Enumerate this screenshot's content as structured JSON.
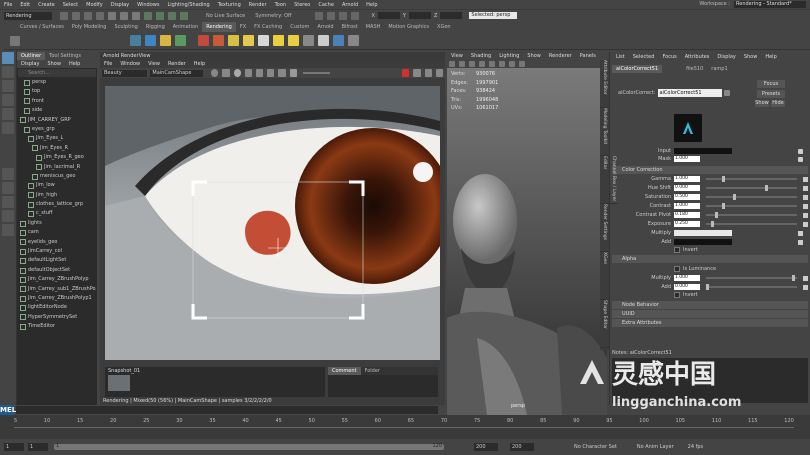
{
  "menubar": {
    "items": [
      "File",
      "Edit",
      "Create",
      "Select",
      "Modify",
      "Display",
      "Windows",
      "Lighting/Shading",
      "Texturing",
      "Render",
      "Toon",
      "Stereo",
      "Cache",
      "Arnold",
      "Help"
    ],
    "workspace_label": "Workspace :",
    "workspace_value": "Rendering - Standard*"
  },
  "statusline": {
    "mode": "Rendering",
    "no_live_surface": "No Live Surface",
    "symmetry": "Symmetry: Off",
    "coord_x": "X",
    "coord_y": "Y",
    "coord_z": "Z",
    "camera_field": "Selected: persp"
  },
  "shelf_tabs": [
    "Curves / Surfaces",
    "Poly Modeling",
    "Sculpting",
    "Rigging",
    "Animation",
    "Rendering",
    "FX",
    "FX Caching",
    "Custom",
    "Arnold",
    "Bifrost",
    "MASH",
    "Motion Graphics",
    "XGen"
  ],
  "outliner": {
    "tabs": [
      "Outliner",
      "Tool Settings"
    ],
    "menu": [
      "Display",
      "Show",
      "Help"
    ],
    "search_placeholder": "Search...",
    "items": [
      "persp",
      "top",
      "front",
      "side",
      "JIM_CARREY_GRP",
      "eyes_grp",
      "Jim_Eyes_L",
      "Jim_Eyes_R",
      "Jim_Eyes_R_geo",
      "Jim_lacrimal_R",
      "meniscus_geo",
      "Jim_low",
      "Jim_high",
      "clothes_lattice_grp",
      "c_stuff",
      "lights",
      "cam",
      "eyelids_geo",
      "JimCarrey_col",
      "defaultLightSet",
      "defaultObjectSet",
      "Jim_Carrey_ZBrushPolyp",
      "Jim_Carrey_sub1_ZBrushPo",
      "Jim_Carrey_ZBrushPolyp1",
      "lightEditorNode",
      "HyperSymmetrySet",
      "TimeEditor"
    ]
  },
  "render_view": {
    "title": "Arnold RenderView",
    "menu": [
      "File",
      "Window",
      "View",
      "Render",
      "Help"
    ],
    "camera": "Beauty",
    "shape": "MainCamShape",
    "snapshot": "Snapshot_01",
    "comment_tab": "Comment",
    "folder_tab": "Folder",
    "status": "Rendering | Mixed(50 (56%) | MainCamShape | samples 3/2/2/2/2/0"
  },
  "viewport": {
    "menu": [
      "View",
      "Shading",
      "Lighting",
      "Show",
      "Renderer",
      "Panels"
    ],
    "hud": [
      {
        "label": "Verts:",
        "value": "930076"
      },
      {
        "label": "Edges:",
        "value": "1997901"
      },
      {
        "label": "Faces:",
        "value": "938424"
      },
      {
        "label": "Tris:",
        "value": "1996048"
      },
      {
        "label": "UVs:",
        "value": "1061017"
      }
    ],
    "camera_label": "persp"
  },
  "attribute_editor": {
    "menu": [
      "List",
      "Selected",
      "Focus",
      "Attributes",
      "Display",
      "Show",
      "Help"
    ],
    "node_tab": "aiColorCorrect51",
    "tab2": "file510",
    "tab3": "ramp1",
    "node_label": "aiColorCorrect:",
    "node_value": "aiColorCorrect51",
    "focus": "Focus",
    "presets": "Presets",
    "show": "Show",
    "hide": "Hide",
    "input_label": "Input",
    "mask_label": "Mask",
    "mask_value": "1.000",
    "section_color_correction": "Color Correction",
    "rows": [
      {
        "label": "Gamma",
        "value": "1.000"
      },
      {
        "label": "Hue Shift",
        "value": "0.000"
      },
      {
        "label": "Saturation",
        "value": "0.500"
      },
      {
        "label": "Contrast",
        "value": "1.000"
      },
      {
        "label": "Contrast Pivot",
        "value": "0.180"
      },
      {
        "label": "Exposure",
        "value": "0.250"
      },
      {
        "label": "Multiply",
        "value": ""
      },
      {
        "label": "Add",
        "value": ""
      }
    ],
    "section_alpha": "Alpha",
    "is_luminance": "Is Luminance",
    "alpha_rows": [
      {
        "label": "Multiply",
        "value": "1.000"
      },
      {
        "label": "Add",
        "value": "0.000"
      }
    ],
    "invert1": "Invert",
    "invert2": "Invert",
    "sections": [
      "Node Behavior",
      "UUID",
      "Extra Attributes"
    ],
    "notes_label": "Notes: aiColorCorrect51",
    "side_tabs": [
      "Attribute Editor",
      "Modeling Toolkit",
      "Channel Box / Layer Editor",
      "Render Settings",
      "XGen",
      "Shape Editor"
    ]
  },
  "timeline": {
    "ticks": [
      "5",
      "10",
      "15",
      "20",
      "25",
      "30",
      "35",
      "40",
      "45",
      "50",
      "55",
      "60",
      "65",
      "70",
      "75",
      "80",
      "85",
      "90",
      "95",
      "100",
      "105",
      "110",
      "115",
      "120"
    ],
    "start": "1",
    "end": "120",
    "range_start": "1",
    "range_end": "120",
    "end2": "200",
    "end3": "200",
    "char_set": "No Character Set",
    "anim_layer": "No Anim Layer",
    "fps": "24 fps"
  },
  "watermark": {
    "brand": "灵感中国",
    "url": "lingganchina.com"
  },
  "script_label": "MEL",
  "colors": {
    "accent": "#5285a6",
    "bg": "#444444",
    "dark": "#2b2b2b"
  }
}
